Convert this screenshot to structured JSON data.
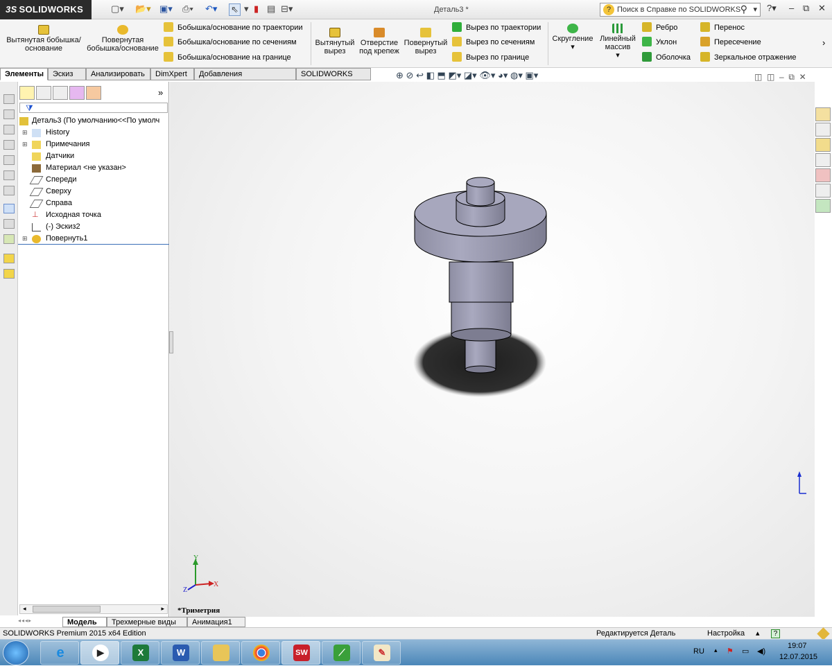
{
  "app": {
    "brand": "SOLIDWORKS",
    "doc_title": "Деталь3 *"
  },
  "help_search": {
    "placeholder": "Поиск в Справке по SOLIDWORKS"
  },
  "ribbon": {
    "extruded_boss": "Вытянутая бобышка/основание",
    "revolved_boss": "Повернутая бобышка/основание",
    "swept_boss": "Бобышка/основание по траектории",
    "lofted_boss": "Бобышка/основание по сечениям",
    "boundary_boss": "Бобышка/основание на границе",
    "extruded_cut": "Вытянутый вырез",
    "hole_wizard": "Отверстие под крепеж",
    "revolved_cut": "Повернутый вырез",
    "swept_cut": "Вырез по траектории",
    "lofted_cut": "Вырез по сечениям",
    "boundary_cut": "Вырез по границе",
    "fillet": "Скругление",
    "linear_pattern": "Линейный массив",
    "rib": "Ребро",
    "draft": "Уклон",
    "shell": "Оболочка",
    "wrap": "Перенос",
    "intersect": "Пересечение",
    "mirror": "Зеркальное отражение"
  },
  "tabs": [
    "Элементы",
    "Эскиз",
    "Анализировать",
    "DimXpert",
    "Добавления SOLIDWORKS",
    "SOLIDWORKS MBD"
  ],
  "tree": {
    "root": "Деталь3  (По умолчанию<<По умолч",
    "items": [
      "History",
      "Примечания",
      "Датчики",
      "Материал <не указан>",
      "Спереди",
      "Сверху",
      "Справа",
      "Исходная точка",
      "(-) Эскиз2",
      "Повернуть1"
    ]
  },
  "bottom_tabs": [
    "Модель",
    "Трехмерные виды",
    "Анимация1"
  ],
  "view_name": "*Триметрия",
  "axes": {
    "x": "X",
    "y": "Y",
    "z": "Z"
  },
  "status": {
    "edition": "SOLIDWORKS Premium 2015 x64 Edition",
    "editing": "Редактируется Деталь",
    "custom": "Настройка"
  },
  "tray": {
    "lang": "RU",
    "time": "19:07",
    "date": "12.07.2015"
  },
  "taskbar_apps": [
    "ie",
    "media-player",
    "excel",
    "word",
    "explorer",
    "chrome",
    "solidworks",
    "3d-app",
    "paint"
  ]
}
